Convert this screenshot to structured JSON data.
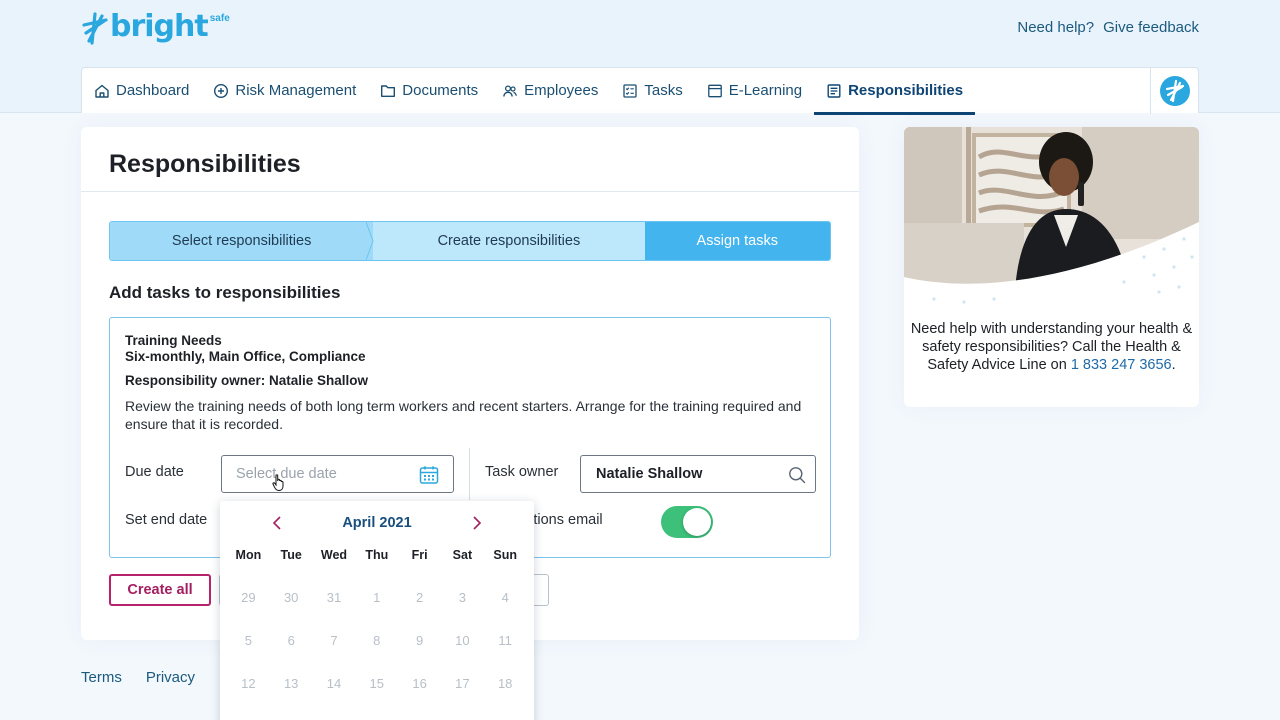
{
  "brand": {
    "name": "bright",
    "superscript": "safe"
  },
  "header_links": {
    "help": "Need help?",
    "feedback": "Give feedback"
  },
  "nav": {
    "items": [
      {
        "label": "Dashboard",
        "icon": "home-icon"
      },
      {
        "label": "Risk Management",
        "icon": "plus-circle-icon"
      },
      {
        "label": "Documents",
        "icon": "folder-icon"
      },
      {
        "label": "Employees",
        "icon": "people-icon"
      },
      {
        "label": "Tasks",
        "icon": "checklist-icon"
      },
      {
        "label": "E-Learning",
        "icon": "browser-icon"
      },
      {
        "label": "Responsibilities",
        "icon": "document-icon"
      }
    ],
    "active": "Responsibilities"
  },
  "page": {
    "title": "Responsibilities"
  },
  "stepper": {
    "steps": [
      "Select responsibilities",
      "Create responsibilities",
      "Assign tasks"
    ],
    "current": "Assign tasks"
  },
  "section": {
    "title": "Add tasks to responsibilities"
  },
  "task": {
    "name_line1": "Training Needs",
    "name_line2": "Six-monthly, Main Office, Compliance",
    "owner_line": "Responsibility owner: Natalie Shallow",
    "description": "Review the training needs of both long term workers and recent starters. Arrange for the training required and ensure that it is recorded.",
    "due_date_label": "Due date",
    "due_date_placeholder": "Select due date",
    "due_date_value": "",
    "task_owner_label": "Task owner",
    "task_owner_value": "Natalie Shallow",
    "end_date_label": "Set end date",
    "notifications_label": "Notifications email",
    "notifications_on": true
  },
  "buttons": {
    "create_all": "Create all"
  },
  "footer": {
    "terms": "Terms",
    "privacy": "Privacy"
  },
  "calendar": {
    "month": "April 2021",
    "weekdays": [
      "Mon",
      "Tue",
      "Wed",
      "Thu",
      "Fri",
      "Sat",
      "Sun"
    ],
    "days": [
      "29",
      "30",
      "31",
      "1",
      "2",
      "3",
      "4",
      "5",
      "6",
      "7",
      "8",
      "9",
      "10",
      "11",
      "12",
      "13",
      "14",
      "15",
      "16",
      "17",
      "18"
    ]
  },
  "promo": {
    "text": "Need help with understanding your health & safety responsibilities? Call the Health & Safety Advice Line on",
    "phone": "1 833 247 3656",
    "suffix": "."
  },
  "colors": {
    "accent": "#2aa7de",
    "nav_active": "#0f4574",
    "step_current": "#44b4ef",
    "toggle_on": "#3cc07a",
    "create_button": "#b7236b"
  }
}
